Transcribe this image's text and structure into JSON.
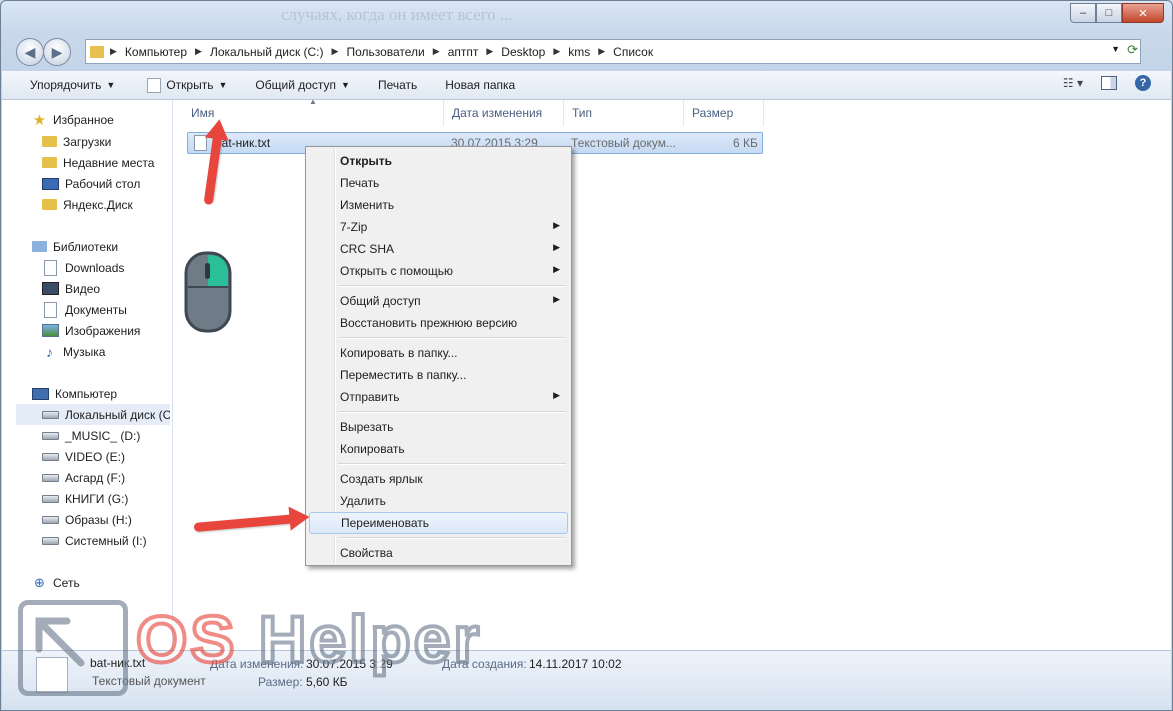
{
  "background_text": "случаях, когда он имеет всего ...",
  "window": {
    "min": "–",
    "max": "□",
    "close": "✕"
  },
  "address": {
    "crumbs": [
      "Компьютер",
      "Локальный диск (C:)",
      "Пользователи",
      "аптпт",
      "Desktop",
      "kms",
      "Список"
    ]
  },
  "toolbar": {
    "organize": "Упорядочить",
    "open": "Открыть",
    "share": "Общий доступ",
    "print": "Печать",
    "new_folder": "Новая папка",
    "help": "?"
  },
  "sidebar": {
    "items": [
      {
        "label": "Избранное",
        "icon": "star-icon"
      },
      {
        "label": "Загрузки",
        "icon": "folder-icon"
      },
      {
        "label": "Недавние места",
        "icon": "folder-icon"
      },
      {
        "label": "Рабочий стол",
        "icon": "desktop-icon"
      },
      {
        "label": "Яндекс.Диск",
        "icon": "folder-icon"
      },
      {
        "label": "Библиотеки",
        "icon": "library-icon"
      },
      {
        "label": "Downloads",
        "icon": "document-icon"
      },
      {
        "label": "Видео",
        "icon": "video-icon"
      },
      {
        "label": "Документы",
        "icon": "document-icon"
      },
      {
        "label": "Изображения",
        "icon": "image-icon"
      },
      {
        "label": "Музыка",
        "icon": "music-icon"
      },
      {
        "label": "Компьютер",
        "icon": "computer-icon"
      },
      {
        "label": "Локальный диск (C:)",
        "icon": "drive-icon"
      },
      {
        "label": "_MUSIC_ (D:)",
        "icon": "drive-icon"
      },
      {
        "label": "VIDEO (E:)",
        "icon": "drive-icon"
      },
      {
        "label": "Асгард (F:)",
        "icon": "drive-icon"
      },
      {
        "label": "КНИГИ (G:)",
        "icon": "drive-icon"
      },
      {
        "label": "Образы (H:)",
        "icon": "drive-icon"
      },
      {
        "label": "Системный (I:)",
        "icon": "drive-icon"
      },
      {
        "label": "Сеть",
        "icon": "network-icon"
      }
    ]
  },
  "columns": {
    "name": "Имя",
    "date": "Дата изменения",
    "type": "Тип",
    "size": "Размер"
  },
  "file": {
    "name": "bat-ник.txt",
    "date": "30.07.2015 3:29",
    "type": "Текстовый докум...",
    "size": "6 КБ"
  },
  "context_menu": {
    "open": "Открыть",
    "print": "Печать",
    "edit": "Изменить",
    "zip": "7-Zip",
    "crc": "CRC SHA",
    "open_with": "Открыть с помощью",
    "share": "Общий доступ",
    "restore": "Восстановить прежнюю версию",
    "copy_to": "Копировать в папку...",
    "move_to": "Переместить в папку...",
    "send_to": "Отправить",
    "cut": "Вырезать",
    "copy": "Копировать",
    "shortcut": "Создать ярлык",
    "delete": "Удалить",
    "rename": "Переименовать",
    "properties": "Свойства"
  },
  "details": {
    "name": "bat-ник.txt",
    "type": "Текстовый документ",
    "modified_label": "Дата изменения:",
    "modified_value": "30.07.2015 3:29",
    "created_label": "Дата создания:",
    "created_value": "14.11.2017 10:02",
    "size_label": "Размер:",
    "size_value": "5,60 КБ"
  },
  "watermark": {
    "part1": "OS",
    "part2": " Helper"
  },
  "colors": {
    "accent_arrow": "#e8463c",
    "selection": "#cfe0f6",
    "mouse_button": "#2bbf99"
  }
}
